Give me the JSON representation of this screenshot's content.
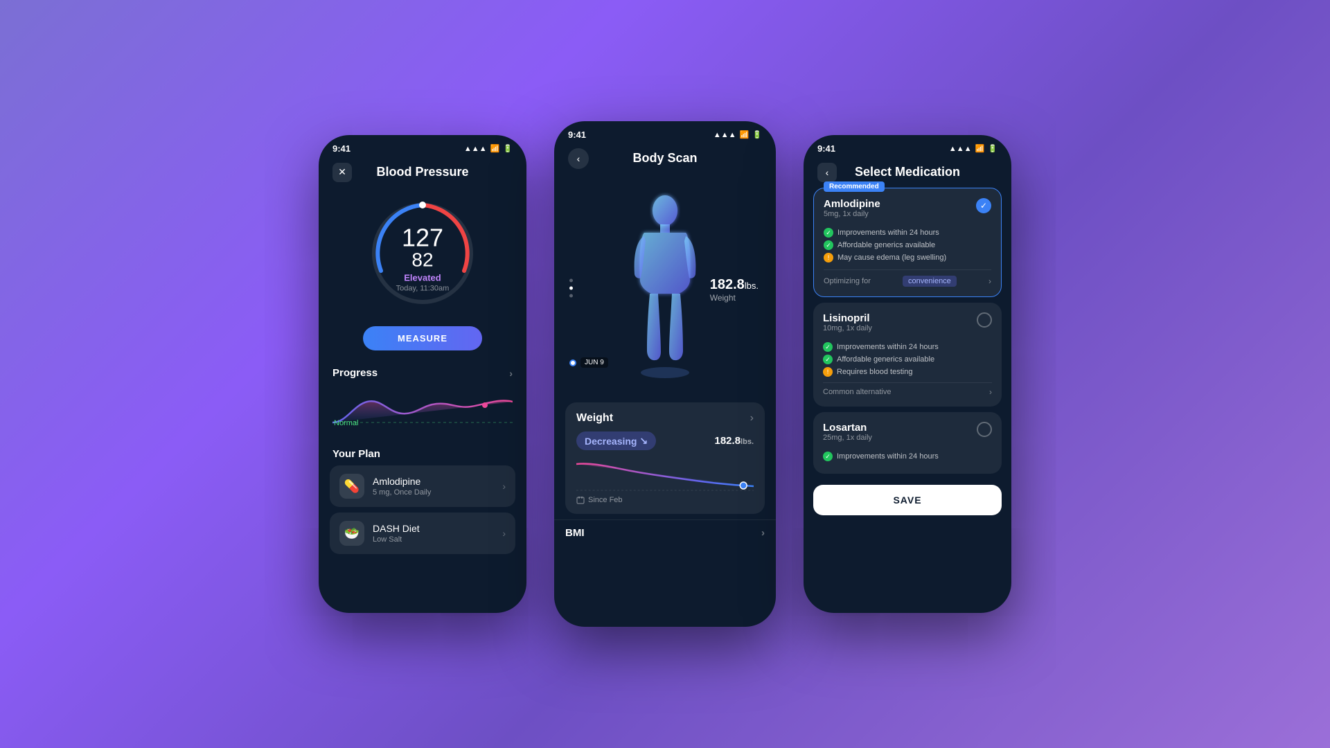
{
  "phones": {
    "left": {
      "title": "Blood Pressure",
      "status_time": "9:41",
      "close_icon": "✕",
      "gauge": {
        "systolic": "127",
        "diastolic": "82",
        "status": "Elevated",
        "time": "Today, 11:30am"
      },
      "measure_btn": "MEASURE",
      "progress": {
        "label": "Progress",
        "normal_label": "Normal"
      },
      "plan": {
        "label": "Your Plan",
        "items": [
          {
            "icon": "💊",
            "name": "Amlodipine",
            "sub": "5 mg, Once Daily"
          },
          {
            "icon": "🥗",
            "name": "DASH Diet",
            "sub": "Low Salt"
          }
        ]
      }
    },
    "center": {
      "title": "Body Scan",
      "status_time": "9:41",
      "weight_value": "182.8",
      "weight_unit": "lbs.",
      "weight_label": "Weight",
      "date_label": "JUN 9",
      "weight_card": {
        "title": "Weight",
        "trend": "Decreasing",
        "trend_icon": "↘",
        "current": "182.8",
        "unit": "lbs.",
        "since_label": "Since Feb"
      },
      "bmi_label": "BMI"
    },
    "right": {
      "title": "Select Medication",
      "status_time": "9:41",
      "medications": [
        {
          "name": "Amlodipine",
          "dosage": "5mg, 1x daily",
          "recommended": true,
          "selected": true,
          "benefits": [
            {
              "type": "green",
              "text": "Improvements within 24 hours"
            },
            {
              "type": "green",
              "text": "Affordable generics available"
            },
            {
              "type": "yellow",
              "text": "May cause edema (leg swelling)"
            }
          ],
          "optimize_label": "Optimizing for",
          "optimize_tag": "convenience"
        },
        {
          "name": "Lisinopril",
          "dosage": "10mg, 1x daily",
          "recommended": false,
          "selected": false,
          "benefits": [
            {
              "type": "green",
              "text": "Improvements within 24 hours"
            },
            {
              "type": "green",
              "text": "Affordable generics available"
            },
            {
              "type": "yellow",
              "text": "Requires blood testing"
            }
          ],
          "common_label": "Common alternative"
        },
        {
          "name": "Losartan",
          "dosage": "25mg, 1x daily",
          "recommended": false,
          "selected": false,
          "benefits": [
            {
              "type": "green",
              "text": "Improvements within 24 hours"
            }
          ]
        }
      ],
      "save_btn": "SAVE"
    }
  }
}
